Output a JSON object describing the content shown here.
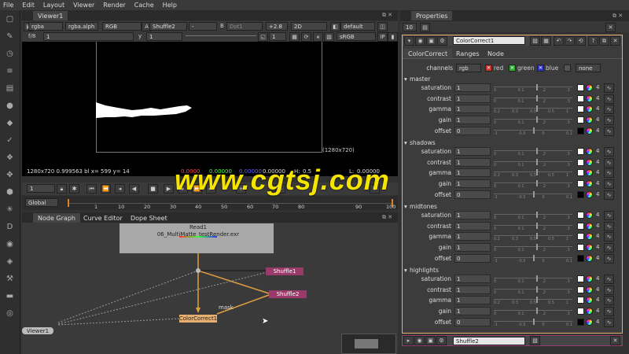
{
  "menu": [
    "File",
    "Edit",
    "Layout",
    "Viewer",
    "Render",
    "Cache",
    "Help"
  ],
  "viewer_tab": "Viewer1",
  "viewer_controls": {
    "channels": "rgba",
    "alpha": "rgba.alph",
    "colorspace": "RGB",
    "a_input": "Shuffle2",
    "ab_sep": "-",
    "b_label": "B",
    "b_input": "Dot1",
    "gain": "+2.8",
    "view_mode": "2D",
    "lut": "default",
    "fstop": "f/8",
    "frame_num": "1",
    "y_label": "y",
    "y_value": "1",
    "zoom": "1",
    "display": "sRGB"
  },
  "format_label": "(1280x720)",
  "readout": {
    "info": "1280x720  0.999563 bl  x= 599 y=  14",
    "r": "0.0000",
    "g": "0.00000",
    "b": "0.00000",
    "a": "0.00000",
    "h": "H:",
    "h_val": "0.5",
    "l": "L:",
    "l_val": "0.00000"
  },
  "playback": {
    "frame": "1"
  },
  "timeline": {
    "mode": "Global",
    "ticks": [
      "1",
      "10",
      "20",
      "30",
      "40",
      "50",
      "60",
      "70",
      "80",
      "90",
      "100"
    ]
  },
  "graph_tabs": [
    "Node Graph",
    "Curve Editor",
    "Dope Sheet"
  ],
  "nodes": {
    "read_name": "Read1",
    "read_file": "06_MultiMatte_testRender.exr",
    "shuffle1": "Shuffle1",
    "shuffle2": "Shuffle2",
    "colorcorrect": "ColorCorrect1",
    "viewer": "Viewer1",
    "mask_label": "mask"
  },
  "props": {
    "title": "Properties",
    "max_panels": "10",
    "node_name": "ColorCorrect1",
    "tabs": [
      "ColorCorrect",
      "Ranges",
      "Node"
    ],
    "channels_label": "channels",
    "channels_value": "rgb",
    "red": "red",
    "green": "green",
    "blue": "blue",
    "none": "none",
    "sections": [
      "master",
      "shadows",
      "midtones",
      "highlights"
    ],
    "param_labels": [
      "saturation",
      "contrast",
      "gamma",
      "gain",
      "offset"
    ],
    "values": [
      "1",
      "1",
      "1",
      "1",
      "0"
    ],
    "ticks_gain": [
      "0",
      "0.1",
      ".2",
      ".3"
    ],
    "ticks_gamma": [
      "0.2",
      "0.3",
      "0.5",
      "0.5",
      "1"
    ],
    "ticks_offset": [
      "-1",
      "-0.5",
      "0",
      "0.1"
    ],
    "badge": "4",
    "bottom_node": "Shuffle2"
  },
  "watermark": "www.cgtsj.com",
  "colors": {
    "watermark": "#f5e400",
    "node_read": "#a8a8a8",
    "node_shuffle": "#9a3a6a",
    "node_cc": "#e8b070",
    "edge": "#e0a040"
  }
}
